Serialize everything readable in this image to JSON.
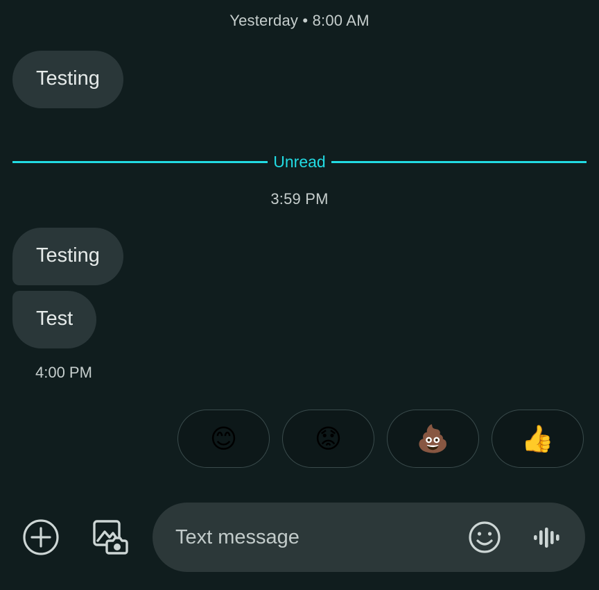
{
  "colors": {
    "background": "#101d1e",
    "bubble": "#2a3739",
    "bubble_text": "#e6ebea",
    "secondary_text": "#c6cecd",
    "unread_accent": "#22dbe3",
    "composer_field": "#2c3839",
    "reaction_border": "#3a4b4c",
    "icon": "#cdd6d5"
  },
  "thread": {
    "day_separator": "Yesterday • 8:00 AM",
    "messages_before_unread": [
      {
        "text": "Testing",
        "shape": "single"
      }
    ],
    "unread_label": "Unread",
    "time_after_unread": "3:59 PM",
    "messages_after_unread": [
      {
        "text": "Testing",
        "shape": "group-top"
      },
      {
        "text": "Test",
        "shape": "group-bottom"
      }
    ],
    "group_timestamp": "4:00 PM"
  },
  "reactions": [
    {
      "name": "reaction-smiling-face",
      "emoji": "😊",
      "label": "smiling face with smiling eyes"
    },
    {
      "name": "reaction-worried-face",
      "emoji": "😟",
      "label": "worried face"
    },
    {
      "name": "reaction-pile-of-poo",
      "emoji": "💩",
      "label": "pile of poo"
    },
    {
      "name": "reaction-thumbs-up",
      "emoji": "👍",
      "label": "thumbs up"
    }
  ],
  "composer": {
    "add_icon": "plus-circle-icon",
    "gallery_icon": "image-camera-icon",
    "placeholder": "Text message",
    "emoji_icon": "smiley-face-icon",
    "mic_icon": "audio-waveform-icon"
  }
}
